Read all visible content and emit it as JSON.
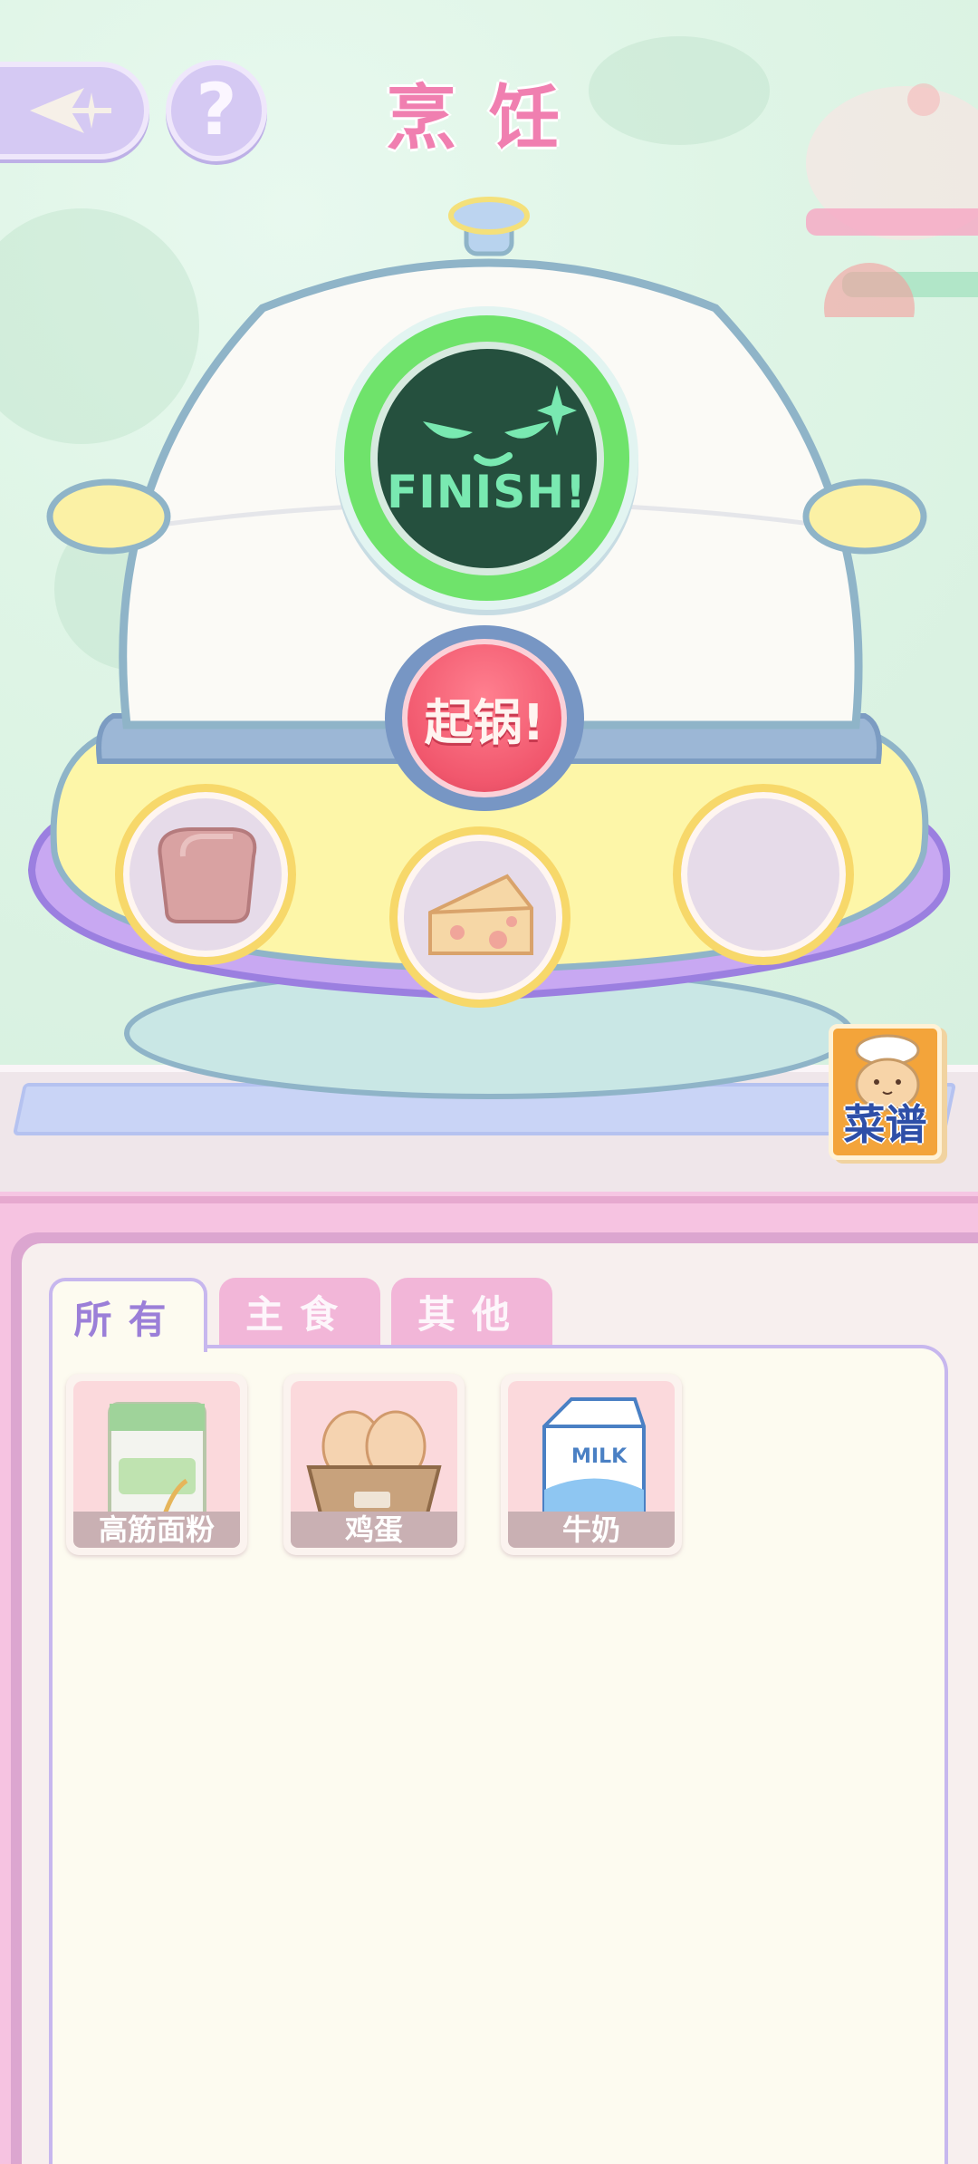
{
  "header": {
    "title": "烹饪",
    "help_label": "?"
  },
  "pot": {
    "status_text": "FINISH!",
    "start_button_label": "起锅!",
    "slots": [
      {
        "item": "bread"
      },
      {
        "item": "cheese"
      },
      {
        "item": ""
      }
    ]
  },
  "recipe_button": {
    "label": "菜谱"
  },
  "inventory": {
    "tabs": [
      {
        "label": "所有",
        "active": true
      },
      {
        "label": "主食",
        "active": false
      },
      {
        "label": "其他",
        "active": false
      }
    ],
    "items": [
      {
        "label": "高筋面粉",
        "icon": "flour-bag-icon"
      },
      {
        "label": "鸡蛋",
        "icon": "eggs-icon"
      },
      {
        "label": "牛奶",
        "icon": "milk-carton-icon"
      }
    ]
  },
  "colors": {
    "title_pink": "#f07fb0",
    "finish_green": "#6fe36b",
    "start_red": "#f1576d",
    "tab_active_text": "#9b7fd8",
    "panel_pink": "#f6c3e1"
  }
}
